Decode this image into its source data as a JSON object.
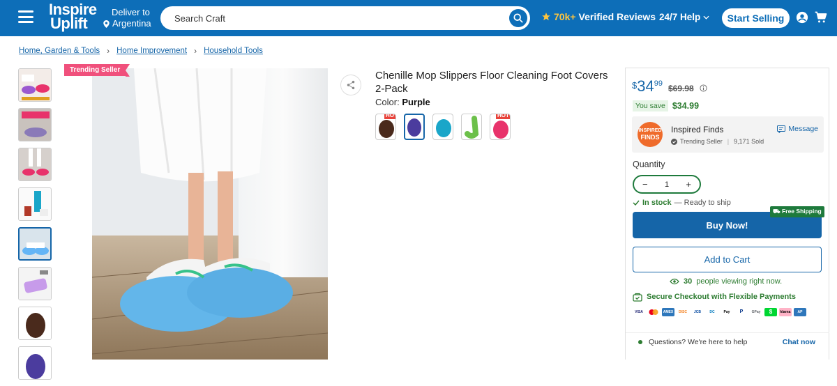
{
  "header": {
    "logo_line1": "Inspire",
    "logo_line2": "Uplift",
    "deliver_label": "Deliver to",
    "deliver_country": "Argentina",
    "search_placeholder": "Search Craft",
    "reviews_count": "70k+",
    "reviews_label": "Verified Reviews",
    "help_label": "24/7 Help",
    "sell_label": "Start Selling"
  },
  "breadcrumb": [
    "Home, Garden & Tools",
    "Home Improvement",
    "Household Tools"
  ],
  "badge": "Trending Seller",
  "product": {
    "title": "Chenille Mop Slippers Floor Cleaning Foot Covers 2-Pack",
    "color_label": "Color:",
    "color_value": "Purple",
    "swatches": [
      {
        "name": "Brown",
        "hot": "HOT",
        "color": "#4a2a1c"
      },
      {
        "name": "Purple",
        "hot": "",
        "color": "#4b3c9e"
      },
      {
        "name": "Blue",
        "hot": "",
        "color": "#1aa6c9"
      },
      {
        "name": "Green",
        "hot": "",
        "color": "#6cc04a"
      },
      {
        "name": "Pink",
        "hot": "HOT",
        "color": "#e8336b"
      }
    ]
  },
  "pricing": {
    "currency": "$",
    "price_int": "34",
    "price_dec": "99",
    "old_price": "$69.98",
    "you_save_label": "You save",
    "you_save_amount": "$34.99"
  },
  "seller": {
    "logo_top": "INSPIRED",
    "logo_bottom": "FINDS",
    "name": "Inspired Finds",
    "badge": "Trending Seller",
    "sold": "9,171 Sold",
    "message_label": "Message"
  },
  "purchase": {
    "quantity_label": "Quantity",
    "quantity_value": "1",
    "stock_status": "In stock",
    "stock_note": "— Ready to ship",
    "free_shipping": "Free Shipping",
    "buy_label": "Buy Now!",
    "cart_label": "Add to Cart",
    "viewing_count": "30",
    "viewing_text": "people viewing right now.",
    "secure_text": "Secure Checkout with Flexible Payments"
  },
  "payments": [
    {
      "name": "VISA",
      "color": "#ffffff"
    },
    {
      "name": "MC",
      "color": "#ffffff"
    },
    {
      "name": "AMEX",
      "color": "#2e77bb"
    },
    {
      "name": "DISC",
      "color": "#ffffff"
    },
    {
      "name": "JCB",
      "color": "#ffffff"
    },
    {
      "name": "DC",
      "color": "#ffffff"
    },
    {
      "name": "Pay",
      "color": "#ffffff"
    },
    {
      "name": "P",
      "color": "#ffffff"
    },
    {
      "name": "GPay",
      "color": "#ffffff"
    },
    {
      "name": "$",
      "color": "#00d632"
    },
    {
      "name": "klarna",
      "color": "#ffb3c7"
    },
    {
      "name": "AP",
      "color": "#2e77bb"
    }
  ],
  "chat": {
    "question": "Questions? We're here to help",
    "action": "Chat now"
  }
}
